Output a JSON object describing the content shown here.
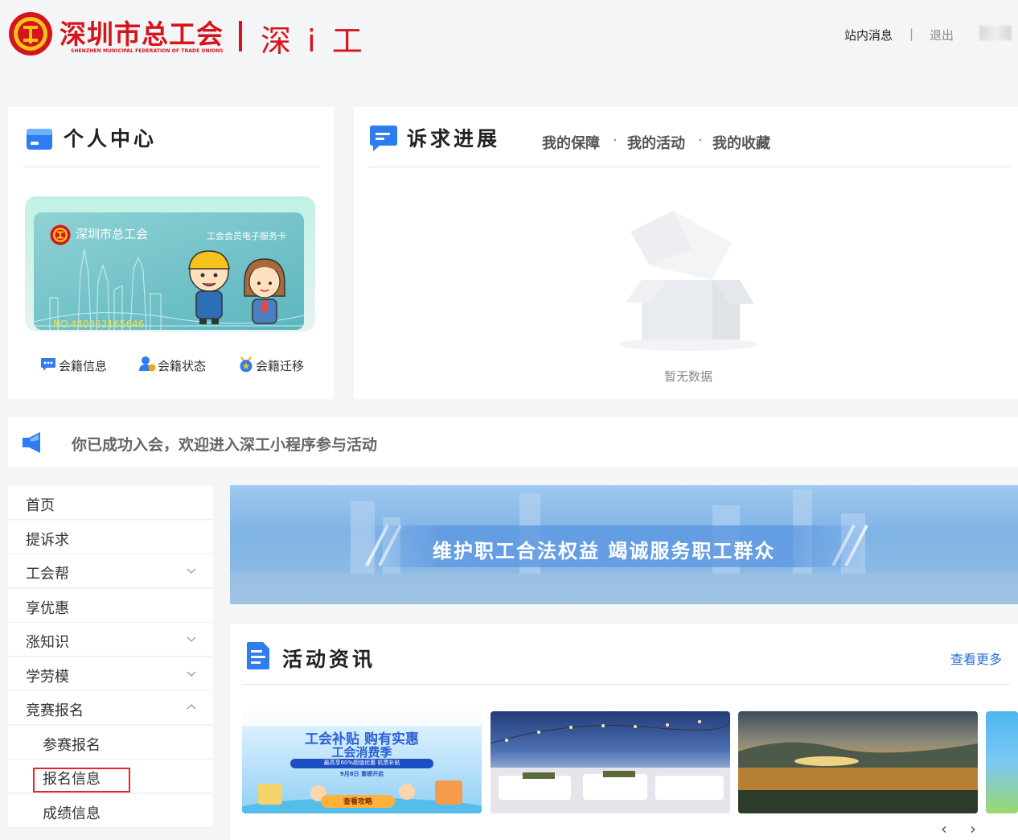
{
  "header": {
    "org_name": "深圳市总工会",
    "org_name_en": "SHENZHEN MUNICIPAL FEDERATION OF TRADE UNIONS",
    "app_name": "深 i 工",
    "messages_link": "站内消息",
    "separator": "|",
    "logout_link": "退出"
  },
  "personal_center": {
    "title": "个人中心",
    "card": {
      "org_name": "深圳市总工会",
      "card_type": "工会会员电子服务卡",
      "number": "NO.440352165646"
    },
    "actions": [
      {
        "label": "会籍信息",
        "icon": "chat-dots-icon"
      },
      {
        "label": "会籍状态",
        "icon": "user-status-icon"
      },
      {
        "label": "会籍迁移",
        "icon": "star-badge-icon"
      }
    ]
  },
  "appeals": {
    "title": "诉求进展",
    "tabs": [
      "我的保障",
      "我的活动",
      "我的收藏"
    ],
    "tab_separator": "·",
    "empty_text": "暂无数据"
  },
  "notice": {
    "text": "你已成功入会，欢迎进入深工小程序参与活动"
  },
  "sidebar": {
    "items": [
      {
        "label": "首页",
        "expandable": false
      },
      {
        "label": "提诉求",
        "expandable": false
      },
      {
        "label": "工会帮",
        "expandable": true,
        "expanded": false
      },
      {
        "label": "享优惠",
        "expandable": false
      },
      {
        "label": "涨知识",
        "expandable": true,
        "expanded": false
      },
      {
        "label": "学劳模",
        "expandable": true,
        "expanded": false
      },
      {
        "label": "竞赛报名",
        "expandable": true,
        "expanded": true
      }
    ],
    "sub_items": [
      {
        "label": "参赛报名"
      },
      {
        "label": "报名信息",
        "highlighted": true
      },
      {
        "label": "成绩信息"
      }
    ]
  },
  "banner": {
    "text": "维护职工合法权益  竭诚服务职工群众"
  },
  "news": {
    "title": "活动资讯",
    "more_link": "查看更多",
    "thumb1": {
      "line1": "工会补贴 购有实惠",
      "line2": "工会消费季",
      "line3": "最高享60%超值优惠 机票补贴",
      "line4": "9月8日 重磅开启",
      "button": "查看攻略"
    },
    "prev_arrow": "‹",
    "next_arrow": "›"
  },
  "colors": {
    "brand_red": "#d5141b",
    "link_blue": "#2b6fd6",
    "icon_blue": "#2d7cf0",
    "highlight_red": "#e8252f"
  }
}
